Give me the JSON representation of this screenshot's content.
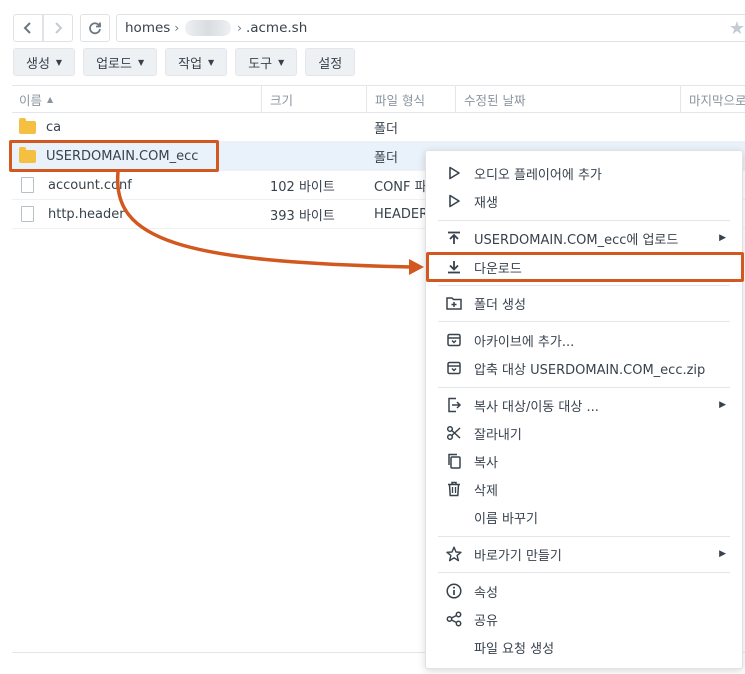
{
  "nav": {
    "path_root": "homes",
    "path_separator": "›",
    "path_leaf": ".acme.sh"
  },
  "toolbar": {
    "buttons": [
      "생성",
      "업로드",
      "작업",
      "도구",
      "설정"
    ]
  },
  "table": {
    "headers": {
      "name": "이름",
      "size": "크기",
      "type": "파일 형식",
      "modified": "수정된 날짜",
      "last": "마지막으로"
    },
    "rows": [
      {
        "name": "ca",
        "size": "",
        "type": "폴더",
        "kind": "folder"
      },
      {
        "name": "USERDOMAIN.COM_ecc",
        "size": "",
        "type": "폴더",
        "kind": "folder"
      },
      {
        "name": "account.conf",
        "size": "102 바이트",
        "type": "CONF 파",
        "kind": "file"
      },
      {
        "name": "http.header",
        "size": "393 바이트",
        "type": "HEADER",
        "kind": "file"
      }
    ]
  },
  "context_menu": {
    "items": [
      {
        "label": "오디오 플레이어에 추가",
        "icon": "play-outline-icon"
      },
      {
        "label": "재생",
        "icon": "play-outline-icon"
      },
      {
        "label": "USERDOMAIN.COM_ecc에 업로드",
        "icon": "upload-icon",
        "submenu": true
      },
      {
        "label": "다운로드",
        "icon": "download-icon"
      },
      {
        "label": "폴더 생성",
        "icon": "new-folder-icon"
      },
      {
        "label": "아카이브에 추가...",
        "icon": "archive-icon"
      },
      {
        "label": "압축 대상 USERDOMAIN.COM_ecc.zip",
        "icon": "archive-icon"
      },
      {
        "label": "복사 대상/이동 대상 ...",
        "icon": "copy-move-icon",
        "submenu": true
      },
      {
        "label": "잘라내기",
        "icon": "scissors-icon"
      },
      {
        "label": "복사",
        "icon": "copy-icon"
      },
      {
        "label": "삭제",
        "icon": "trash-icon"
      },
      {
        "label": "이름 바꾸기",
        "icon": ""
      },
      {
        "label": "바로가기 만들기",
        "icon": "star-outline-icon",
        "submenu": true
      },
      {
        "label": "속성",
        "icon": "info-icon"
      },
      {
        "label": "공유",
        "icon": "share-icon"
      },
      {
        "label": "파일 요청 생성",
        "icon": ""
      }
    ]
  },
  "colors": {
    "highlight": "#d2581f",
    "selected_row": "#e9f1fa",
    "folder": "#f5c042"
  }
}
